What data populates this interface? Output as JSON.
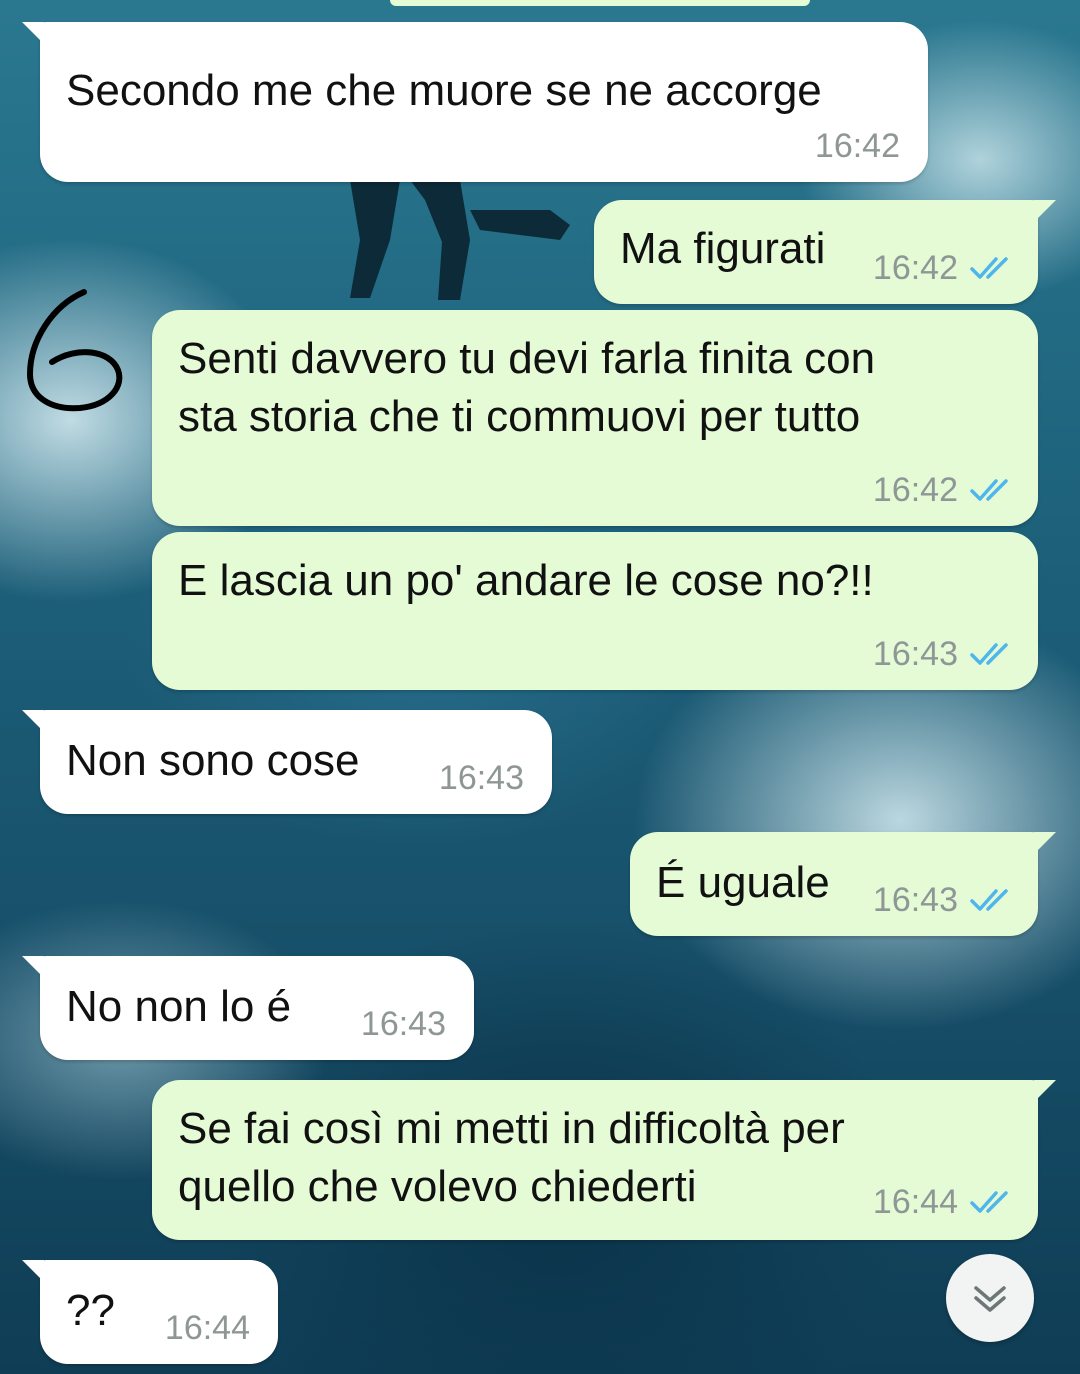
{
  "annotation": "6",
  "messages": [
    {
      "direction": "incoming",
      "text_lines": [
        "Secondo me che muore se ne accorge"
      ],
      "time": "16:42"
    },
    {
      "direction": "outgoing",
      "text_lines": [
        "Ma figurati"
      ],
      "time": "16:42",
      "status": "read"
    },
    {
      "direction": "outgoing",
      "text_lines": [
        "Senti davvero tu devi farla finita con",
        "sta storia che ti commuovi per tutto"
      ],
      "time": "16:42",
      "status": "read"
    },
    {
      "direction": "outgoing",
      "text_lines": [
        "E lascia un po' andare le cose no?!!"
      ],
      "time": "16:43",
      "status": "read"
    },
    {
      "direction": "incoming",
      "text_lines": [
        "Non sono cose"
      ],
      "time": "16:43"
    },
    {
      "direction": "outgoing",
      "text_lines": [
        "É uguale"
      ],
      "time": "16:43",
      "status": "read"
    },
    {
      "direction": "incoming",
      "text_lines": [
        "No non lo é"
      ],
      "time": "16:43"
    },
    {
      "direction": "outgoing",
      "text_lines": [
        "Se fai così mi metti in difficoltà per",
        "quello che volevo chiederti"
      ],
      "time": "16:44",
      "status": "read"
    },
    {
      "direction": "incoming",
      "text_lines": [
        "??"
      ],
      "time": "16:44"
    }
  ],
  "icons": {
    "read_receipt": "double-check-icon",
    "scroll_down": "chevron-down-double-icon"
  },
  "colors": {
    "incoming_bubble": "#ffffff",
    "outgoing_bubble": "#e4fbd6",
    "read_tick": "#4fb6ec",
    "timestamp": "#8e9796"
  }
}
